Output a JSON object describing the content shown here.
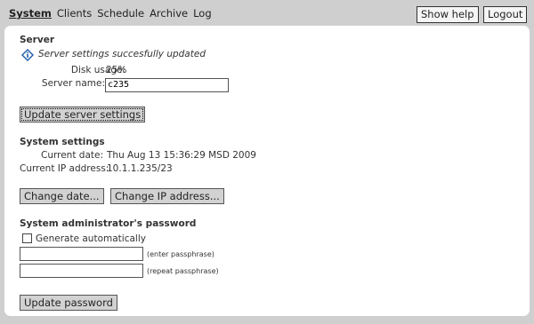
{
  "nav": {
    "items": [
      "System",
      "Clients",
      "Schedule",
      "Archive",
      "Log"
    ],
    "show_help": "Show help",
    "logout": "Logout"
  },
  "server": {
    "heading": "Server",
    "notice": "Server settings succesfully updated",
    "disk_usage_label": "Disk usage:",
    "disk_usage_value": "25%",
    "server_name_label": "Server name:",
    "server_name_value": "c235",
    "update_button": "Update server settings"
  },
  "system_settings": {
    "heading": "System settings",
    "current_date_label": "Current date:",
    "current_date_value": "Thu Aug 13 15:36:29 MSD 2009",
    "current_ip_label": "Current IP address:",
    "current_ip_value": "10.1.1.235/23",
    "change_date_button": "Change date...",
    "change_ip_button": "Change IP address..."
  },
  "password": {
    "heading": "System administrator's password",
    "generate_label": "Generate automatically",
    "generate_checked": false,
    "enter_hint": "(enter passphrase)",
    "repeat_hint": "(repeat passphrase)",
    "enter_value": "",
    "repeat_value": "",
    "update_button": "Update password"
  },
  "icons": {
    "info": "info-icon"
  },
  "colors": {
    "background": "#cfcfcf",
    "panel": "#ffffff",
    "button": "#d2d2d2",
    "info_icon": "#1f5fa8"
  }
}
